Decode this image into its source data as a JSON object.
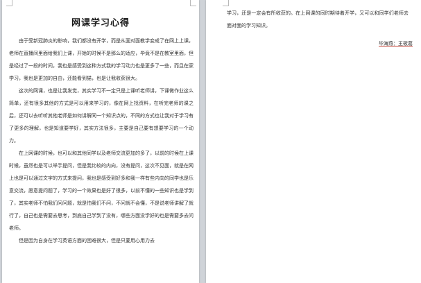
{
  "document": {
    "title": "网课学习心得",
    "page1": {
      "p1": "由于受新冠肺炎的影响，我们都没有开学，而是从面对面教学变成了在网上上课，老师在直播间里面给我们上课，开始的时候不是那么的适应，毕竟不是在教室里面，但是经过了一段的时间，我也是感受到这种方式我的学习动力也是更多了一些，而且在家学习，我也是更加的自由，还能看到猫，也是让我收获很大。",
      "p2": "这次的网课，也是让我发觉，其实学习不一定只是上课听老师讲，下课做作业这么简单，还有很多其他的方式是可以用来学习的，像在网上找资料，在听完老师的课之后，还可以去听听其他老师是如何讲解同一个知识点的，不同的方式也让我对于学习有了更多的理解，也是知道要学好，其实方法很多，主要是自己要有想要学习的一个动力。",
      "p3": "在上网课的时候，也可以和其他同学以及老师交流更加的多了，以前的时候在上课时候，虽然也是可以举手提问，但是我比较的内向，没有提问，这次不见面，就是在网上也是可以通过文字的方式来提问，我也是感受到好多和我一样有些内向的同学也是乐意交流，愿意提问题了，学习的一个效果也是好了很多，以前不懂的一些知识也是学到了，其实老师不怕我们问问题，就是怕我们不问，不问就不会懂，不是说老师讲解了就行了，自己也是需要去思考，到底自己学到了没有，哪些方面没学好的也是需要多去问老师。",
      "p4": "但是因为自身在学习英语方面的困难很大，但是只要用心用力去"
    },
    "page2": {
      "p1": "学习，还是一定会有所收获的。在上网课的同时期待着开学，又可以和同学们老师去面对面的学习知识。",
      "signature": "毕海燕：王筱葛"
    }
  }
}
